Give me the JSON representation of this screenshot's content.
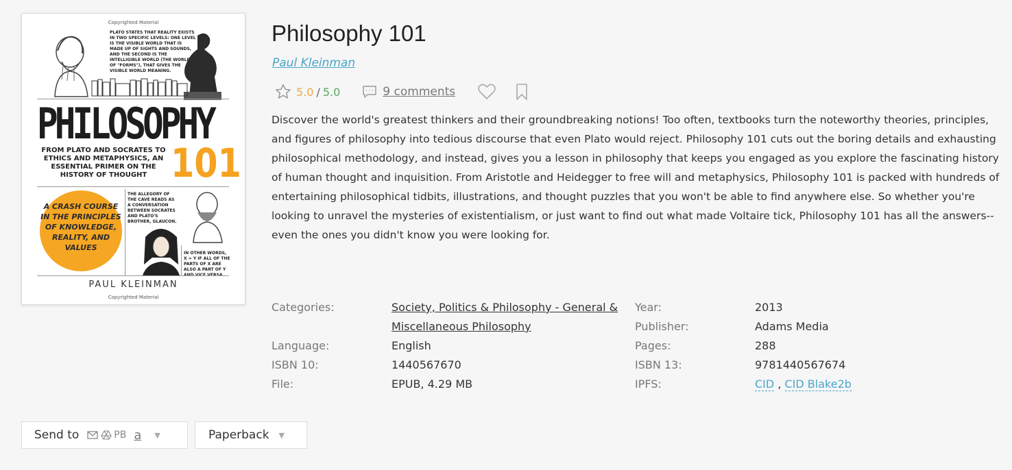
{
  "book": {
    "title": "Philosophy 101",
    "author": "Paul Kleinman",
    "rating": "5.0",
    "rating_max": "5.0",
    "comments": "9 comments",
    "description": "Discover the world's greatest thinkers and their groundbreaking notions! Too often, textbooks turn the noteworthy theories, principles, and figures of philosophy into tedious discourse that even Plato would reject. Philosophy 101 cuts out the boring details and exhausting philosophical methodology, and instead, gives you a lesson in philosophy that keeps you engaged as you explore the fascinating history of human thought and inquisition. From Aristotle and Heidegger to free will and metaphysics, Philosophy 101 is packed with hundreds of entertaining philosophical tidbits, illustrations, and thought puzzles that you won't be able to find anywhere else. So whether you're looking to unravel the mysteries of existentialism, or just want to find out what made Voltaire tick, Philosophy 101 has all the answers--even the ones you didn't know you were looking for."
  },
  "cover": {
    "copyright": "Copyrighted Material",
    "top_text": "PLATO STATES THAT REALITY EXISTS IN TWO SPECIFIC LEVELS: ONE LEVEL IS THE VISIBLE WORLD THAT IS MADE UP OF SIGHTS AND SOUNDS, AND THE SECOND IS THE INTELLIGIBLE WORLD (THE WORLD OF \"FORMS\"), THAT GIVES THE VISIBLE WORLD MEANING.",
    "title": "PHILOSOPHY",
    "subtitle": "FROM PLATO AND SOCRATES TO ETHICS AND METAPHYSICS, AN ESSENTIAL PRIMER ON THE HISTORY OF THOUGHT",
    "number": "101",
    "badge": "A CRASH COURSE IN THE PRINCIPLES OF KNOWLEDGE, REALITY, AND VALUES",
    "allegory": "THE ALLEGORY OF THE CAVE READS AS A CONVERSATION BETWEEN SOCRATES AND PLATO'S BROTHER, GLAUCON.",
    "other_words": "IN OTHER WORDS, X = Y IF ALL OF THE PARTS OF X ARE ALSO A PART OF Y AND VICE VERSA.",
    "author": "PAUL KLEINMAN"
  },
  "details": {
    "categories_label": "Categories:",
    "categories_value": "Society, Politics & Philosophy - General & Miscellaneous Philosophy",
    "language_label": "Language:",
    "language_value": "English",
    "isbn10_label": "ISBN 10:",
    "isbn10_value": "1440567670",
    "file_label": "File:",
    "file_value": "EPUB, 4.29 MB",
    "year_label": "Year:",
    "year_value": "2013",
    "publisher_label": "Publisher:",
    "publisher_value": "Adams Media",
    "pages_label": "Pages:",
    "pages_value": "288",
    "isbn13_label": "ISBN 13:",
    "isbn13_value": "9781440567674",
    "ipfs_label": "IPFS:",
    "ipfs_cid": "CID",
    "ipfs_separator": ",",
    "ipfs_cid_blake": "CID Blake2b"
  },
  "actions": {
    "send_to_label": "Send to",
    "send_to_pb": "PB",
    "send_to_amazon": "a",
    "format_label": "Paperback"
  },
  "icons": {
    "rating": "star-icon",
    "comments": "comment-icon",
    "favorite": "heart-icon",
    "bookmark": "bookmark-icon",
    "email": "mail-icon",
    "drive": "drive-icon",
    "dropdown": "caret-down-icon"
  },
  "colors": {
    "link": "#49a6c7",
    "rating": "#f0a93a",
    "rating_max": "#5aa860",
    "cover_accent": "#f5a623"
  }
}
